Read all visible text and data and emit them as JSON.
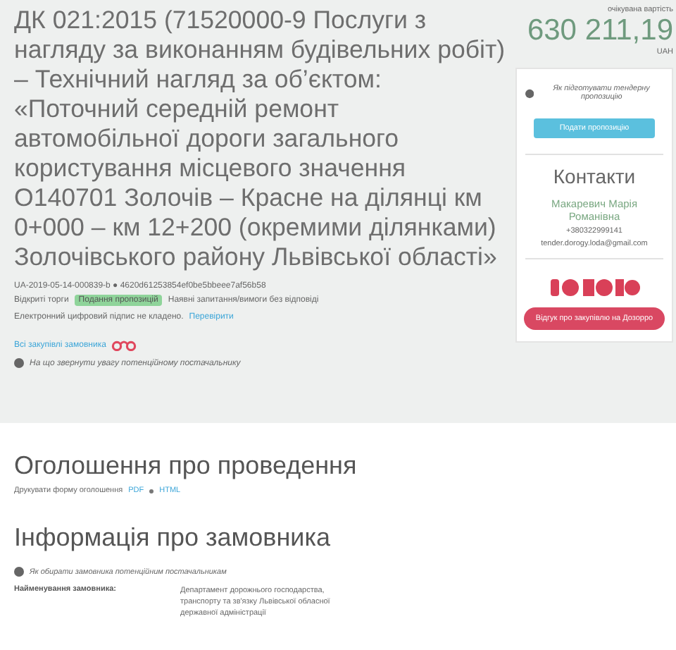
{
  "tender": {
    "title": "ДК 021:2015 (71520000-9 Послуги з нагляду за виконанням будівельних робіт) – Технічний нагляд за об’єктом: «Поточний середній ремонт автомобільної дороги загального користування місцевого значення О140701 Золочів – Красне на ділянці км 0+000 – км 12+200 (окремими ділянками) Золочівського району Львівської області»",
    "id_line": "UA-2019-05-14-000839-b ● 4620d61253854ef0be5bbeee7af56b58",
    "status_label": "Відкриті торги",
    "status_badge": "Подання пропозицій",
    "status_note": "Наявні запитання/вимоги без відповіді",
    "signature_text": "Електронний цифровий підпис не кладено.",
    "signature_link": "Перевірити",
    "all_purchases_link": "Всі закупівлі замовника",
    "help_note": "На що звернути увагу потенційному постачальнику"
  },
  "sidebar": {
    "amount_label": "очікувана вартість",
    "amount": "630 211,19",
    "currency": "UAH",
    "help_note": "Як підготувати тендерну пропозицію",
    "submit_button": "Подати пропозицію",
    "contacts_title": "Контакти",
    "contact_name": "Макаревич Марія Романівна",
    "phone": "+380322999141",
    "email": "tender.dorogy.loda@gmail.com",
    "review_button": "Відгук про закупівлю на Дозорро"
  },
  "announcement": {
    "title": "Оголошення про проведення",
    "print_label": "Друкувати форму оголошення",
    "links": [
      "PDF",
      "HTML"
    ]
  },
  "customer": {
    "title": "Інформація про замовника",
    "help_note": "Як обирати замовника потенційним постачальникам",
    "fields": [
      {
        "label": "Найменування замовника:",
        "value": "Департамент дорожнього господарства, транспорту та зв'язку Львівської обласної державної адміністрації"
      }
    ]
  }
}
